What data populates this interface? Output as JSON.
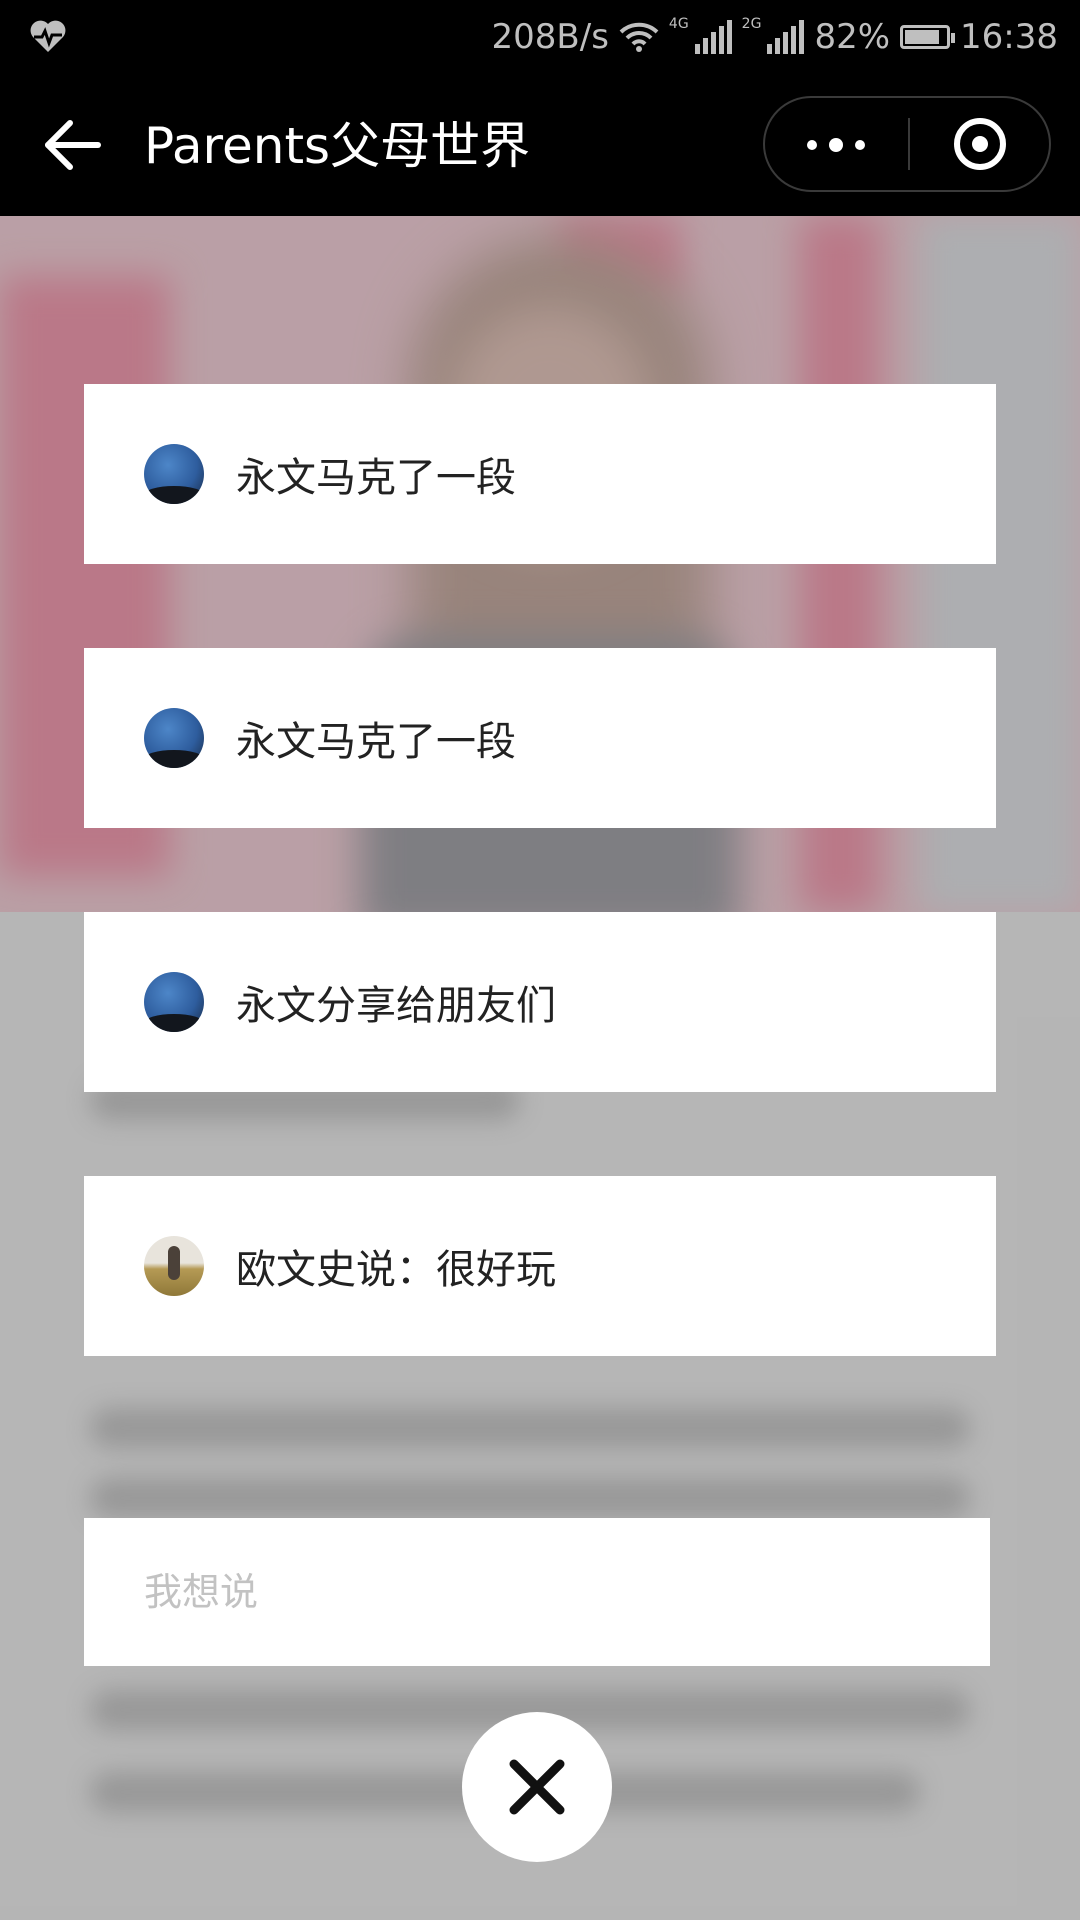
{
  "status_bar": {
    "net_speed": "208B/s",
    "net1": "4G",
    "net2": "2G",
    "battery": "82%",
    "time": "16:38"
  },
  "title_bar": {
    "title": "Parents父母世界"
  },
  "share_items": [
    {
      "text": "永文马克了一段",
      "avatar": "sky"
    },
    {
      "text": "永文马克了一段",
      "avatar": "sky"
    },
    {
      "text": "永文分享给朋友们",
      "avatar": "sky"
    },
    {
      "text": "欧文史说：很好玩",
      "avatar": "field"
    }
  ],
  "comment_input": {
    "placeholder": "我想说"
  },
  "icons": {
    "back": "arrow-left-icon",
    "more": "more-dots-icon",
    "capsule_close": "target-circle-icon",
    "close": "close-x-icon"
  }
}
